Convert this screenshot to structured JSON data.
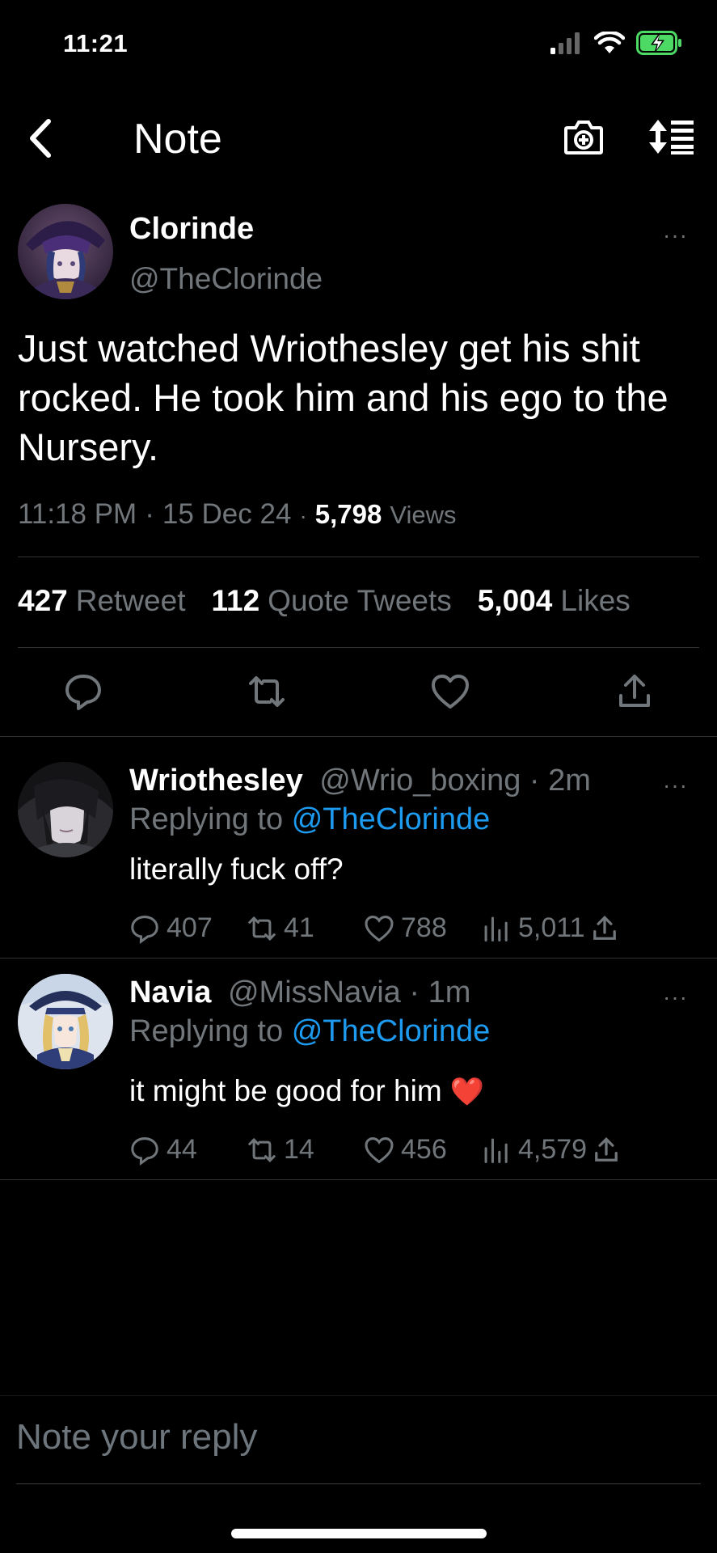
{
  "status_bar": {
    "time": "11:21"
  },
  "header": {
    "title": "Note"
  },
  "tweet": {
    "name": "Clorinde",
    "handle": "@TheClorinde",
    "text": "Just watched Wriothesley get his shit rocked. He took him and his ego to the Nursery.",
    "time": "11:18 PM",
    "date": "15 Dec 24",
    "separator": "·",
    "views_count": "5,798",
    "views_label": "Views",
    "retweets_count": "427",
    "retweets_label": "Retweet",
    "quotes_count": "112",
    "quotes_label": "Quote Tweets",
    "likes_count": "5,004",
    "likes_label": "Likes",
    "more": "···"
  },
  "replies": [
    {
      "name": "Wriothesley",
      "handle_time": "@Wrio_boxing · 2m",
      "replying_label": "Replying to",
      "replying_handle": "@TheClorinde",
      "text": "literally fuck off?",
      "replies": "407",
      "retweets": "41",
      "likes": "788",
      "views": "5,011",
      "more": "···"
    },
    {
      "name": "Navia",
      "handle_time": "@MissNavia · 1m",
      "replying_label": "Replying to",
      "replying_handle": "@TheClorinde",
      "text": "it might be good for him",
      "emoji": "❤️",
      "replies": "44",
      "retweets": "14",
      "likes": "456",
      "views": "4,579",
      "more": "···"
    }
  ],
  "compose": {
    "placeholder": "Note your reply"
  },
  "colors": {
    "background": "#000000",
    "accent": "#1d9bf0",
    "muted": "#71767b",
    "divider": "#2f3336",
    "battery": "#4cd964"
  }
}
